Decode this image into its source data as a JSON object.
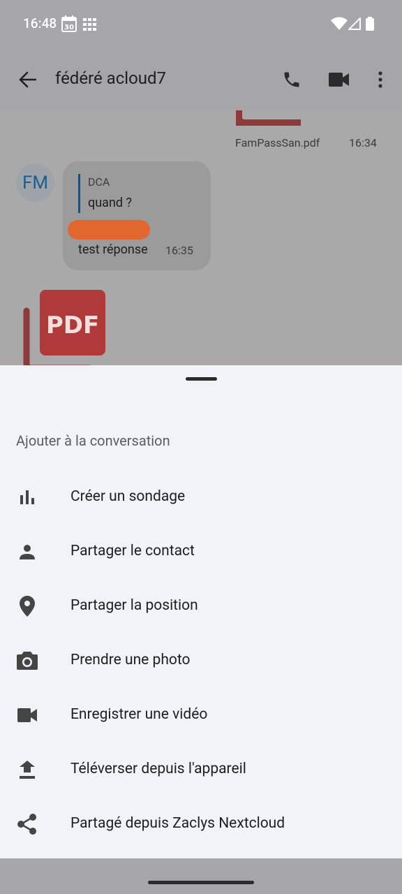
{
  "status_bar": {
    "time": "16:48",
    "calendar_day": "30"
  },
  "app_bar": {
    "title": "fédéré acloud7"
  },
  "chat": {
    "file_message": {
      "file_name": "FamPassSan.pdf",
      "time": "16:34"
    },
    "reply_message": {
      "avatar_initials": "FM",
      "quoted_author": "DCA",
      "quoted_text": "quand ?",
      "text": "test réponse",
      "time": "16:35"
    },
    "pdf_label": "PDF"
  },
  "sheet": {
    "title": "Ajouter à la conversation",
    "items": [
      {
        "label": "Créer un sondage",
        "icon": "poll-icon"
      },
      {
        "label": "Partager le contact",
        "icon": "person-icon"
      },
      {
        "label": "Partager la position",
        "icon": "location-pin-icon"
      },
      {
        "label": "Prendre une photo",
        "icon": "camera-icon"
      },
      {
        "label": "Enregistrer une vidéo",
        "icon": "videocam-icon"
      },
      {
        "label": "Téléverser depuis l'appareil",
        "icon": "upload-icon"
      },
      {
        "label": "Partagé depuis Zaclys Nextcloud",
        "icon": "share-icon"
      }
    ]
  },
  "colors": {
    "pdf_red": "#b03a3a",
    "redaction": "#e2672f",
    "avatar_text": "#1e5e8c"
  }
}
